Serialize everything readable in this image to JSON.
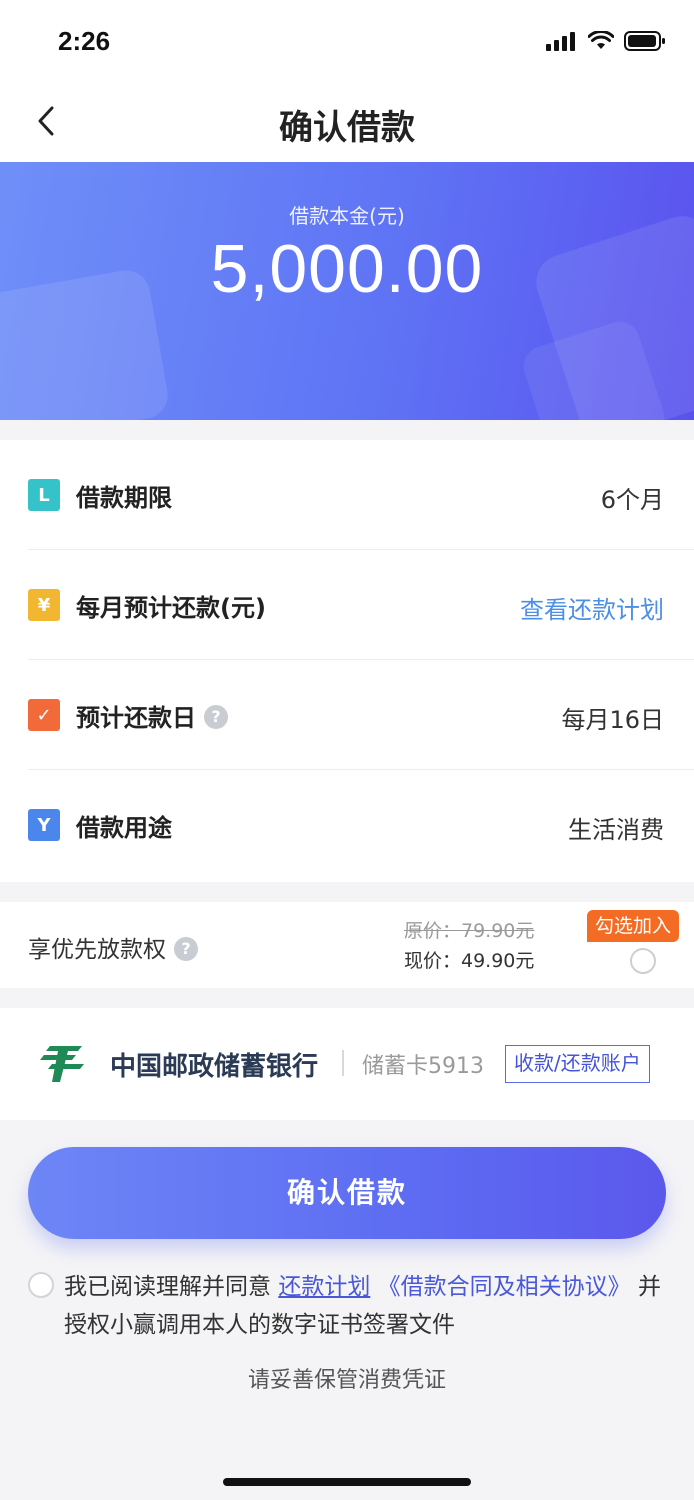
{
  "status": {
    "time": "2:26"
  },
  "nav": {
    "title": "确认借款"
  },
  "hero": {
    "label": "借款本金(元)",
    "amount": "5,000.00"
  },
  "info": {
    "rows": [
      {
        "label": "借款期限",
        "value": "6个月",
        "icon": "L",
        "icon_color": "#36c2c9"
      },
      {
        "label": "每月预计还款(元)",
        "value": "查看还款计划",
        "icon": "¥",
        "icon_color": "#f3b630"
      },
      {
        "label": "预计还款日",
        "value": "每月16日",
        "icon": "✓",
        "icon_color": "#f26a3a"
      },
      {
        "label": "借款用途",
        "value": "生活消费",
        "icon": "Y",
        "icon_color": "#4a86ec"
      }
    ],
    "help_glyph": "?"
  },
  "priority": {
    "label": "享优先放款权",
    "original_price": "原价：79.90元",
    "current_price": "现价：49.90元",
    "badge": "勾选加入"
  },
  "bank": {
    "name": "中国邮政储蓄银行",
    "card": "储蓄卡5913",
    "account_button": "收款/还款账户"
  },
  "confirm_button": "确认借款",
  "agreement": {
    "prefix": "我已阅读理解并同意",
    "link1": "还款计划",
    "link2": "《借款合同及相关协议》",
    "suffix": "并授权小赢调用本人的数字证书签署文件"
  },
  "footer_note": "请妥善保管消费凭证",
  "colors": {
    "accent": "#5d6cf2",
    "link": "#4b8fe8",
    "badge": "#f46c24"
  }
}
